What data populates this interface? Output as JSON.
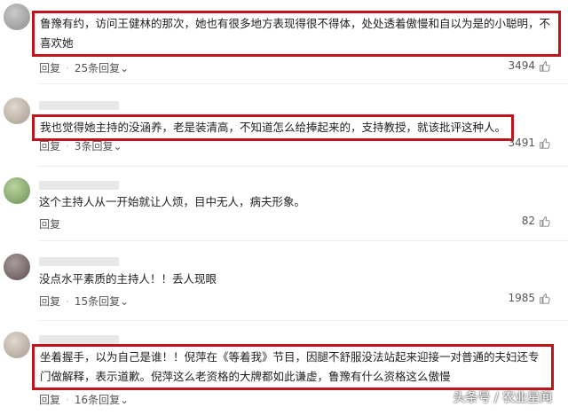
{
  "comments": [
    {
      "text": "鲁豫有约，访问王健林的那次，她也有很多地方表现得很不得体，处处透着傲慢和自以为是的小聪明，不喜欢她",
      "reply": "回复",
      "replies": "25条回复",
      "likes": "3494"
    },
    {
      "text": "我也觉得她主持的没涵养，老是装清高，不知道怎么给捧起来的，支持教授，就该批评这种人。",
      "reply": "回复",
      "replies": "3条回复",
      "likes": "3491"
    },
    {
      "text": "这个主持人从一开始就让人烦，目中无人，病夫形象。",
      "reply": "回复",
      "replies": "",
      "likes": "82"
    },
    {
      "text": "没点水平素质的主持人！！丢人现眼",
      "reply": "回复",
      "replies": "15条回复",
      "likes": "1985"
    },
    {
      "text": "坐着握手，以为自己是谁！！倪萍在《等着我》节目，因腿不舒服没法站起来迎接一对普通的夫妇还专门做解释，表示道歉。倪萍这么老资格的大牌都如此谦虚，鲁豫有什么资格这么傲慢",
      "reply": "回复",
      "replies": "16条回复",
      "likes": ""
    }
  ],
  "watermark": "头条号 / 农业星闻",
  "colors": {
    "highlight_border": "#c0141d",
    "text": "#222222",
    "meta": "#555555"
  }
}
